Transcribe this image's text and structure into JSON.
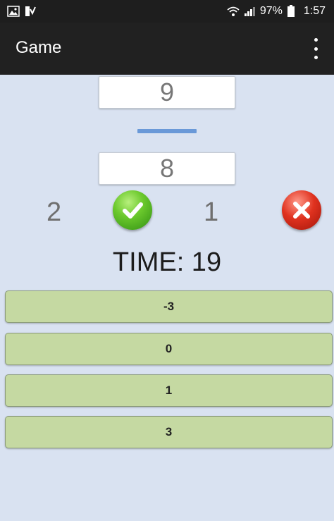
{
  "status_bar": {
    "battery": "97%",
    "time": "1:57",
    "icons": [
      "image-icon",
      "notification-icon",
      "wifi-icon",
      "signal-icon",
      "battery-icon"
    ]
  },
  "app_bar": {
    "title": "Game",
    "menu_icon": "overflow-menu-icon"
  },
  "game": {
    "first_number": "9",
    "operator": "minus",
    "second_number": "8",
    "correct_count": "2",
    "wrong_count": "1",
    "timer_label": "TIME: 19"
  },
  "answers": [
    "-3",
    "0",
    "1",
    "3"
  ],
  "colors": {
    "background": "#d9e2f1",
    "app_bar": "#212121",
    "answer_button": "#c5d9a2",
    "operator_bar": "#6a99d8"
  }
}
